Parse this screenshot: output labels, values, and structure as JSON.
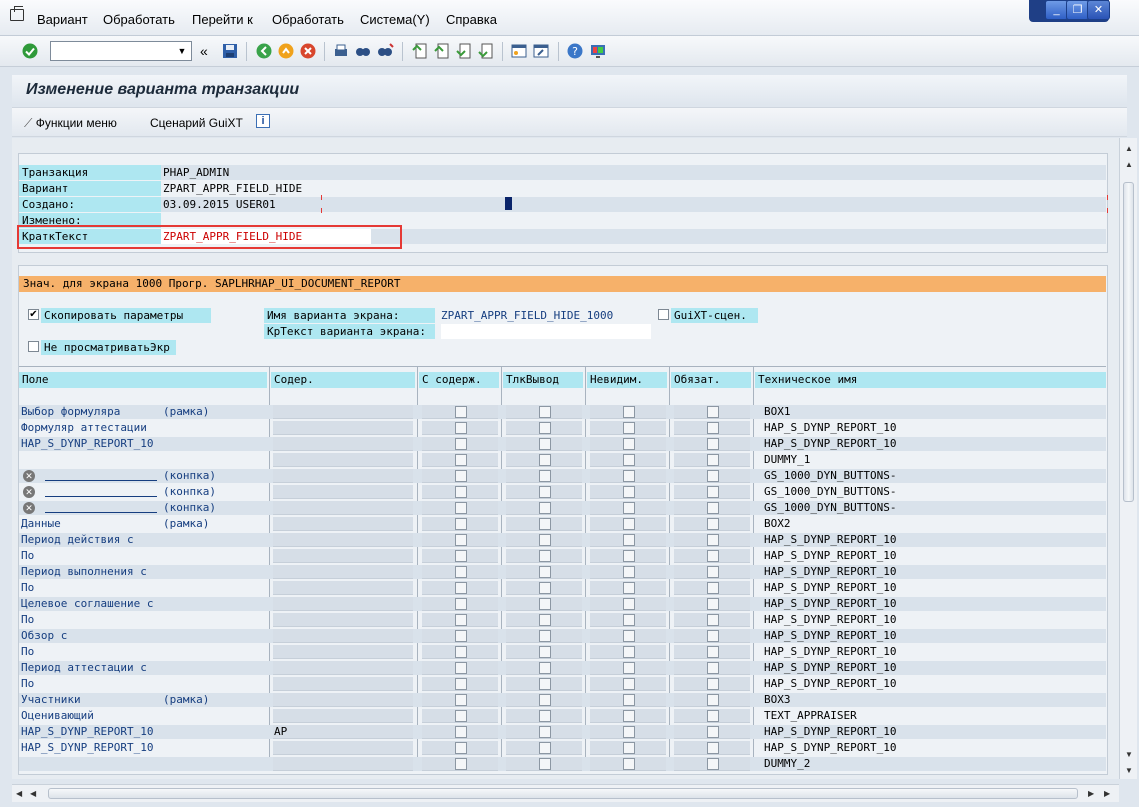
{
  "menu": {
    "items": [
      "Вариант",
      "Обработать",
      "Перейти к",
      "Обработать",
      "Система(Y)",
      "Справка"
    ]
  },
  "window_controls": [
    "_",
    "❐",
    "✕"
  ],
  "toolbar": {
    "command_value": "",
    "icons": [
      "enter-icon",
      "save-icon",
      "back-icon",
      "exit-icon",
      "cancel-icon",
      "print-icon",
      "find-icon",
      "find-next-icon",
      "first-page-icon",
      "prev-page-icon",
      "next-page-icon",
      "last-page-icon",
      "new-session-icon",
      "shortcut-icon",
      "help-icon",
      "customize-icon"
    ]
  },
  "title": "Изменение варианта транзакции",
  "app_toolbar": {
    "functions_menu": "Функции меню",
    "guixt_scenario": "Сценарий GuiXT",
    "info": "i"
  },
  "header": {
    "fields": [
      {
        "label": "Транзакция",
        "value": "PHAP_ADMIN"
      },
      {
        "label": "Вариант",
        "value": "ZPART_APPR_FIELD_HIDE"
      },
      {
        "label": "Создано:",
        "value": "03.09.2015 USER01"
      },
      {
        "label": "Изменено:",
        "value": ""
      },
      {
        "label": "КраткТекст",
        "value": "ZPART_APPR_FIELD_HIDE"
      }
    ]
  },
  "screen_section": {
    "banner": "Знач. для экрана 1000 Прогр.   SAPLHRHAP_UI_DOCUMENT_REPORT",
    "copy_params_label": "Скопировать параметры",
    "copy_params_checked": true,
    "no_view_label": "Не просматриватьЭкр",
    "no_view_checked": false,
    "screen_variant_name_label": "Имя варианта экрана:",
    "screen_variant_name_value": "ZPART_APPR_FIELD_HIDE_1000",
    "screen_variant_text_label": "КрТекст варианта экрана:",
    "screen_variant_text_value": "",
    "guixt_label": "GuiXT-сцен.",
    "guixt_checked": false
  },
  "table": {
    "columns": [
      "Поле",
      "Содер.",
      "С содерж.",
      "ТлкВывод",
      "Невидим.",
      "Обязат.",
      "Техническое имя"
    ],
    "rows": [
      {
        "field": "Выбор формуляра",
        "suffix": "(рамка)",
        "icon": false,
        "content": "",
        "tech": "BOX1"
      },
      {
        "field": "Формуляр аттестации",
        "suffix": "",
        "icon": false,
        "content": "",
        "tech": "HAP_S_DYNP_REPORT_10"
      },
      {
        "field": "HAP_S_DYNP_REPORT_10",
        "suffix": "",
        "icon": false,
        "content": "",
        "tech": "HAP_S_DYNP_REPORT_10"
      },
      {
        "field": "",
        "suffix": "",
        "icon": false,
        "content": "",
        "tech": "DUMMY_1"
      },
      {
        "field": "",
        "suffix": "(конпка)",
        "icon": true,
        "content": "",
        "tech": "GS_1000_DYN_BUTTONS-"
      },
      {
        "field": "",
        "suffix": "(конпка)",
        "icon": true,
        "content": "",
        "tech": "GS_1000_DYN_BUTTONS-"
      },
      {
        "field": "",
        "suffix": "(конпка)",
        "icon": true,
        "content": "",
        "tech": "GS_1000_DYN_BUTTONS-"
      },
      {
        "field": "Данные",
        "suffix": "(рамка)",
        "icon": false,
        "content": "",
        "tech": "BOX2"
      },
      {
        "field": "Период действия с",
        "suffix": "",
        "icon": false,
        "content": "",
        "tech": "HAP_S_DYNP_REPORT_10"
      },
      {
        "field": "По",
        "suffix": "",
        "icon": false,
        "content": "",
        "tech": "HAP_S_DYNP_REPORT_10"
      },
      {
        "field": "Период выполнения с",
        "suffix": "",
        "icon": false,
        "content": "",
        "tech": "HAP_S_DYNP_REPORT_10"
      },
      {
        "field": "По",
        "suffix": "",
        "icon": false,
        "content": "",
        "tech": "HAP_S_DYNP_REPORT_10"
      },
      {
        "field": "Целевое соглашение с",
        "suffix": "",
        "icon": false,
        "content": "",
        "tech": "HAP_S_DYNP_REPORT_10"
      },
      {
        "field": "По",
        "suffix": "",
        "icon": false,
        "content": "",
        "tech": "HAP_S_DYNP_REPORT_10"
      },
      {
        "field": "Обзор с",
        "suffix": "",
        "icon": false,
        "content": "",
        "tech": "HAP_S_DYNP_REPORT_10"
      },
      {
        "field": "По",
        "suffix": "",
        "icon": false,
        "content": "",
        "tech": "HAP_S_DYNP_REPORT_10"
      },
      {
        "field": "Период аттестации с",
        "suffix": "",
        "icon": false,
        "content": "",
        "tech": "HAP_S_DYNP_REPORT_10"
      },
      {
        "field": "По",
        "suffix": "",
        "icon": false,
        "content": "",
        "tech": "HAP_S_DYNP_REPORT_10"
      },
      {
        "field": "Участники",
        "suffix": "(рамка)",
        "icon": false,
        "content": "",
        "tech": "BOX3"
      },
      {
        "field": "Оценивающий",
        "suffix": "",
        "icon": false,
        "content": "",
        "tech": "TEXT_APPRAISER"
      },
      {
        "field": "HAP_S_DYNP_REPORT_10",
        "suffix": "",
        "icon": false,
        "content": "AP",
        "tech": "HAP_S_DYNP_REPORT_10"
      },
      {
        "field": "HAP_S_DYNP_REPORT_10",
        "suffix": "",
        "icon": false,
        "content": "",
        "tech": "HAP_S_DYNP_REPORT_10"
      },
      {
        "field": "",
        "suffix": "",
        "icon": false,
        "content": "",
        "tech": "DUMMY_2"
      }
    ]
  },
  "colors": {
    "label_bg": "#aee7f1",
    "banner_bg": "#f6b16a",
    "highlight": "#e53935",
    "field_text": "#163e80"
  }
}
